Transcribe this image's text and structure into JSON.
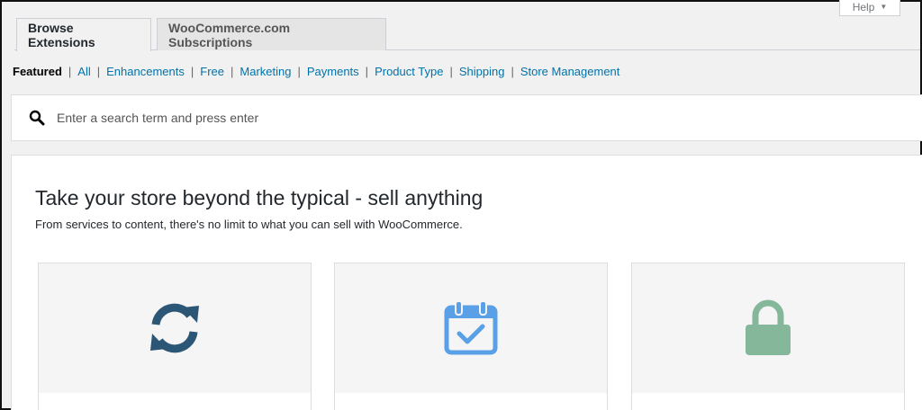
{
  "help": {
    "label": "Help",
    "caret": "▼"
  },
  "tabs": [
    {
      "label": "Browse Extensions"
    },
    {
      "label": "WooCommerce.com Subscriptions"
    }
  ],
  "subnav": {
    "current": "Featured",
    "separator": "|",
    "links": [
      "All",
      "Enhancements",
      "Free",
      "Marketing",
      "Payments",
      "Product Type",
      "Shipping",
      "Store Management"
    ]
  },
  "search": {
    "placeholder": "Enter a search term and press enter",
    "icon": "search-icon"
  },
  "banner": {
    "title": "Take your store beyond the typical - sell anything",
    "subtitle": "From services to content, there's no limit to what you can sell with WooCommerce."
  },
  "cards": [
    {
      "icon": "sync-icon",
      "color": "#2c5675"
    },
    {
      "icon": "calendar-check-icon",
      "color": "#5aa0e6"
    },
    {
      "icon": "lock-icon",
      "color": "#85b89a"
    }
  ],
  "colors": {
    "link": "#0073aa",
    "background": "#f1f1f1"
  }
}
